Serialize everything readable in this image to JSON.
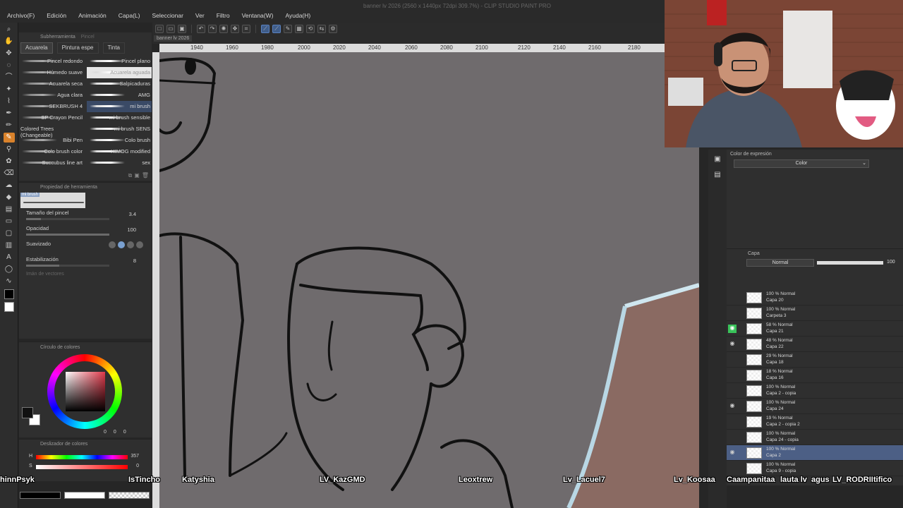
{
  "window": {
    "title": "banner lv 2026 (2560 x 1440px 72dpi 309.7%) - CLIP STUDIO PAINT PRO"
  },
  "menu": [
    "Archivo(F)",
    "Edición",
    "Animación",
    "Capa(L)",
    "Seleccionar",
    "Ver",
    "Filtro",
    "Ventana(W)",
    "Ayuda(H)"
  ],
  "document_tab": "banner lv 2026",
  "ruler": [
    "1940",
    "1960",
    "1980",
    "2000",
    "2020",
    "2040",
    "2060",
    "2080",
    "2100",
    "2120",
    "2140",
    "2160",
    "2180"
  ],
  "subtool": {
    "header": "Subherramienta",
    "header2": "Pincel",
    "tabs": [
      "Acuarela",
      "Pintura espe",
      "Tinta"
    ],
    "brushes_left": [
      "Pincel redondo",
      "Húmedo suave",
      "Acuarela seca",
      "Agua clara",
      "SEKBRUSH 4",
      "SP Crayon Pencil",
      "Colored Trees (Changeable)",
      "Bibi Pen",
      "Colo brush color",
      "Succubus line art"
    ],
    "brushes_right": [
      "Pincel plano",
      "Acuarela aguada",
      "Salpicaduras",
      "AMG",
      "mi brush",
      "mi brush sensible",
      "mi brush SENS",
      "Colo brush",
      "HIMOG modified",
      "sex"
    ]
  },
  "tool_property": {
    "header": "Propiedad de herramienta",
    "preview_name": "mi brush",
    "size_label": "Tamaño del pincel",
    "size_value": "3.4",
    "opacity_label": "Opacidad",
    "opacity_value": "100",
    "smoothing_label": "Suavizado",
    "stabilization_label": "Estabilización",
    "stabilization_value": "8",
    "vector_label": "Imán de vectores"
  },
  "color_wheel": {
    "header": "Círculo de colores",
    "values": [
      "0",
      "0",
      "0"
    ]
  },
  "color_slider": {
    "header": "Deslizador de colores",
    "h_label": "H",
    "h_value": "357",
    "s_label": "S",
    "s_value": "0"
  },
  "expression_color": {
    "header": "Color de expresión",
    "value": "Color"
  },
  "layer_panel": {
    "tab": "Capa",
    "blend_mode": "Normal",
    "opacity": "100",
    "layers": [
      {
        "l1": "100 % Normal",
        "l2": "Capa 20",
        "eye": ""
      },
      {
        "l1": "100 % Normal",
        "l2": "Carpeta 3",
        "eye": ""
      },
      {
        "l1": "58 % Normal",
        "l2": "Capa 21",
        "eye": "green"
      },
      {
        "l1": "48 % Normal",
        "l2": "Capa 22",
        "eye": "on"
      },
      {
        "l1": "29 % Normal",
        "l2": "Capa 18",
        "eye": ""
      },
      {
        "l1": "18 % Normal",
        "l2": "Capa 16",
        "eye": ""
      },
      {
        "l1": "100 % Normal",
        "l2": "Capa 2 - copia",
        "eye": ""
      },
      {
        "l1": "100 % Normal",
        "l2": "Capa 24",
        "eye": "on"
      },
      {
        "l1": "19 % Normal",
        "l2": "Capa 2 - copia 2",
        "eye": ""
      },
      {
        "l1": "100 % Normal",
        "l2": "Capa 24 - copia",
        "eye": ""
      },
      {
        "l1": "100 % Normal",
        "l2": "Capa 2",
        "eye": "on",
        "sel": true
      },
      {
        "l1": "100 % Normal",
        "l2": "Capa 9 - copia",
        "eye": ""
      }
    ]
  },
  "overlay_names": [
    "hinnPsyk",
    "IsTincho",
    "Katyshia",
    "LV_KazGMD",
    "Leoxtrew",
    "Lv_Lacuel7",
    "Lv_Koosaa",
    "Caampanitaa",
    "lauta lv",
    "agus",
    "LV_RODRII",
    "tifico"
  ],
  "colors": {
    "accent": "#d9822b",
    "selection": "#4c5f85",
    "canvas": "#6f6b6d",
    "visible_green": "#39c35a"
  }
}
